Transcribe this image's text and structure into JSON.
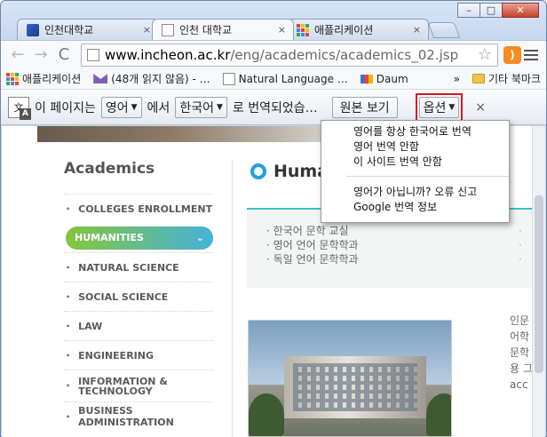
{
  "window": {
    "controls": {
      "minimize": "–",
      "maximize": "□",
      "close": "✕"
    }
  },
  "tabs": [
    {
      "title": "인천대학교",
      "close": "×",
      "icon": "site-logo-icon",
      "active": false
    },
    {
      "title": "인천 대학교",
      "close": "×",
      "icon": "page-icon",
      "active": true
    },
    {
      "title": "애플리케이션",
      "close": "×",
      "icon": "apps-grid-icon",
      "active": false
    }
  ],
  "toolbar": {
    "back": "←",
    "forward": "→",
    "reload": "C",
    "url_host": "www.incheon.ac.kr",
    "url_path": "/eng/academics/academics_02.jsp",
    "star": "☆"
  },
  "bookmarks": {
    "items": [
      {
        "label": "애플리케이션",
        "icon": "apps-grid-icon"
      },
      {
        "label": "(48개 읽지 않음) - …",
        "icon": "mail-icon"
      },
      {
        "label": "Natural Language …",
        "icon": "page-icon"
      },
      {
        "label": "Daum",
        "icon": "daum-icon"
      }
    ],
    "more": "»",
    "other": "기타 북마크"
  },
  "translate_bar": {
    "prefix": "이 페이지는",
    "source_lang": "영어",
    "middle": "에서",
    "target_lang": "한국어",
    "suffix": "로 번역되었습…",
    "original_button": "원본 보기",
    "options_button": "옵션",
    "close": "×"
  },
  "options_menu": [
    "영어를 항상 한국어로 번역",
    "영어 번역 안함",
    "이 사이트 번역 안함",
    "영어가 아닙니까? 오류 신고",
    "Google 번역 정보"
  ],
  "page": {
    "sidebar_title": "Academics",
    "sidebar_items": [
      "COLLEGES  ENROLLMENT",
      "HUMANITIES",
      "NATURAL SCIENCE",
      "SOCIAL SCIENCE",
      "LAW",
      "ENGINEERING",
      "INFORMATION & TECHNOLOGY",
      "BUSINESS ADMINISTRATION"
    ],
    "active_item": "HUMANITIES",
    "content_title": "Huma",
    "departments": [
      "한국어 문학 교실",
      "영어 언어 문학학과",
      "독일 언어 문학학과"
    ],
    "dept_col2": [
      "·",
      "·",
      "·"
    ],
    "side_text": [
      "인문",
      "어학",
      "문학",
      "용 그",
      "acc"
    ]
  }
}
